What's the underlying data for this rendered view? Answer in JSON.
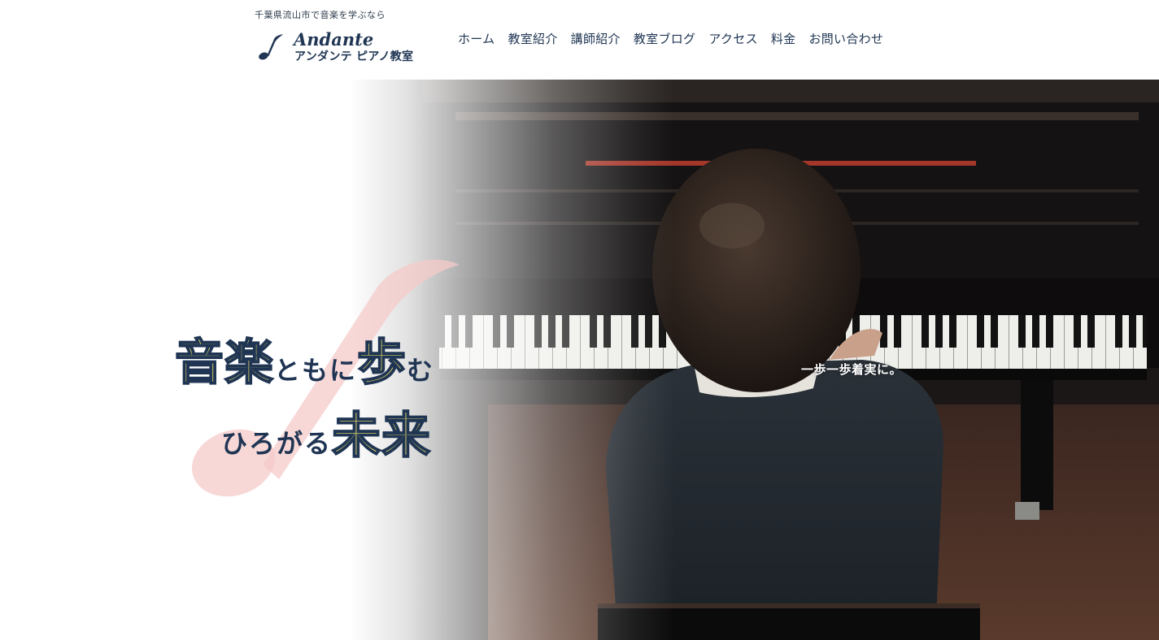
{
  "header": {
    "tagline": "千葉県流山市で音楽を学ぶなら",
    "logo": {
      "en": "Andante",
      "jp": "アンダンテ ピアノ教室",
      "icon": "music-note-icon"
    },
    "nav": [
      {
        "label": "ホーム"
      },
      {
        "label": "教室紹介"
      },
      {
        "label": "講師紹介"
      },
      {
        "label": "教室ブログ"
      },
      {
        "label": "アクセス"
      },
      {
        "label": "料金"
      },
      {
        "label": "お問い合わせ"
      }
    ]
  },
  "hero": {
    "catch_line1": {
      "part1": "音楽",
      "part2": "ともに",
      "part3": "歩",
      "part4": "む"
    },
    "catch_line2": {
      "part1": "ひろがる",
      "part2": "未来"
    },
    "sub_copy": "一歩一歩着実に。",
    "photo": "child-playing-piano-photo"
  },
  "colors": {
    "brand_navy": "#1f3553",
    "accent_yellow": "#f2e36a",
    "note_pink": "#f6c9c9"
  }
}
